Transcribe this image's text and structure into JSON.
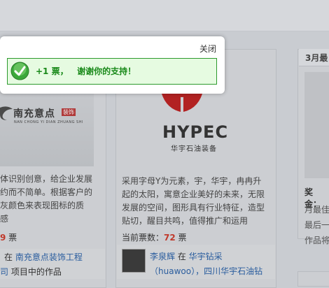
{
  "popup": {
    "close_label": "关闭",
    "message": "+1 票，   谢谢你的支持！"
  },
  "left_card": {
    "logo_name": "南充意点",
    "logo_badge": "装饰",
    "logo_sub": "NAN CHONG YI DIAN ZHUANG SHI",
    "desc_lines": [
      "体识别创意，给企业发展",
      "约而不简单。根据客户的",
      "灰颜色来表现图标的质",
      "感"
    ],
    "votes_num": "9",
    "votes_unit": " 票",
    "author_line1_prefix": "在 ",
    "author_line1_link": "南充意点装饰工程",
    "author_line2_link": "司",
    "author_line2_suffix": " 项目中的作品"
  },
  "mid_card": {
    "logo_name": "HYPEC",
    "logo_sub": "华宇石油装备",
    "desc_lines": [
      "采用字母Y为元素，宇，华宇，冉冉升",
      "起的太阳，寓意企业美好的未来，无限",
      "发展的空间，图形具有行业特征，造型",
      "贴切，醒目共鸣，值得推广和运用"
    ],
    "votes_label": "当前票数：",
    "votes_num": "72",
    "votes_unit": " 票",
    "author_name": "李泉辉",
    "author_in": " 在 ",
    "project_link": "华宇钻采",
    "author_line2": "（huawoo），四川华宇石油钻"
  },
  "right_card": {
    "title": "3月最",
    "prize_label": "奖金：",
    "desc_lines": [
      "月最佳",
      "最后一",
      "作品将"
    ]
  }
}
